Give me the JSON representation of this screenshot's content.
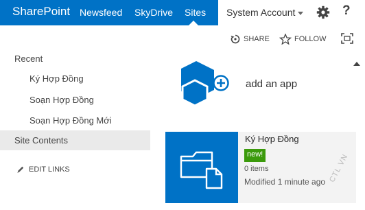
{
  "suite_bar": {
    "brand": "SharePoint",
    "nav": [
      "Newsfeed",
      "SkyDrive",
      "Sites"
    ],
    "active": "Sites",
    "account": "System Account",
    "help": "?"
  },
  "action_bar": {
    "share": "SHARE",
    "follow": "FOLLOW"
  },
  "quick_launch": {
    "recent": "Recent",
    "items": [
      "Ký Hợp Đồng",
      "Soạn Hợp Đồng",
      "Soạn Hợp Đồng Mới"
    ],
    "site_contents": "Site Contents",
    "edit_links": "EDIT LINKS"
  },
  "main": {
    "add_app": "add an app",
    "tile": {
      "title": "Ký Hợp Đồng",
      "badge": "new!",
      "count": "0 items",
      "modified": "Modified 1 minute ago"
    }
  },
  "watermark": "CTL VN",
  "colors": {
    "suite_blue": "#0072c6",
    "tile_blue": "#0072c6",
    "badge_green": "#3b9a0b"
  },
  "icons": {
    "settings": "gear-icon",
    "share": "share-icon",
    "follow": "star-icon",
    "focus": "focus-on-content-icon",
    "edit": "pencil-icon",
    "app": "add-app-icon",
    "library": "folder-document-icon"
  }
}
